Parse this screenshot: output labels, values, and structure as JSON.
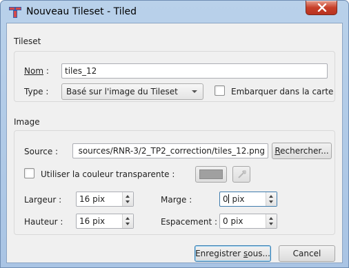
{
  "window": {
    "title": "Nouveau Tileset - Tiled"
  },
  "tileset": {
    "section_label": "Tileset",
    "name_label": "Nom",
    "name_label_suffix": " :",
    "name_value": "tiles_12",
    "type_label": "Type :",
    "type_value": "Basé sur l'image du Tileset",
    "embed_label": "Embarquer dans la carte"
  },
  "image": {
    "section_label": "Image",
    "source_label": "Source :",
    "source_value": "sources/RNR-3/2_TP2_correction/tiles_12.png",
    "browse_label_u": "R",
    "browse_label_rest": "echercher...",
    "transparent_label": "Utiliser la couleur transparente :",
    "transparent_color": "#a0a0a0",
    "width_label": "Largeur :",
    "width_value": "16 pix",
    "height_label": "Hauteur :",
    "height_value": "16 pix",
    "margin_label": "Marge :",
    "margin_value_before_caret": "0",
    "margin_value_after_caret": " pix",
    "spacing_label": "Espacement :",
    "spacing_value": "0 pix"
  },
  "buttons": {
    "save_as_before": "Enregistrer ",
    "save_as_u": "s",
    "save_as_after": "ous...",
    "cancel": "Cancel"
  },
  "icons": {
    "app": "tiled-icon",
    "close": "close-icon",
    "eyedropper": "eyedropper-icon"
  },
  "colors": {
    "titlebar": "#b9d1ea",
    "close_button": "#c7402a",
    "focus_border": "#3d7bad"
  }
}
